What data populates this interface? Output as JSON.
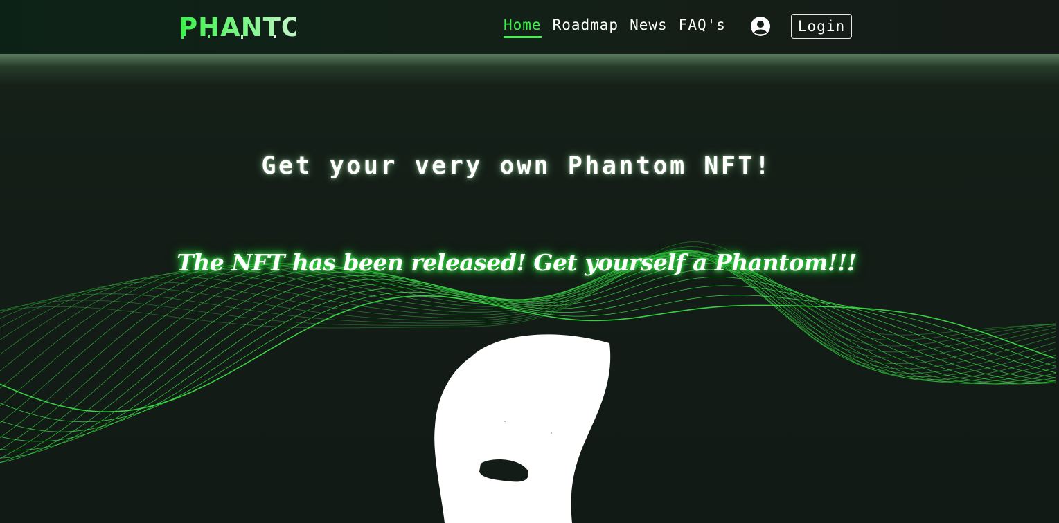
{
  "brand": {
    "logo_text": "PHANTOM",
    "accent_color": "#3df04a"
  },
  "nav": {
    "links": [
      {
        "label": "Home",
        "active": true
      },
      {
        "label": "Roadmap",
        "active": false
      },
      {
        "label": "News",
        "active": false
      },
      {
        "label": "FAQ's",
        "active": false
      }
    ],
    "user_icon": "user-circle-icon",
    "login_label": "Login"
  },
  "hero": {
    "title": "Get your very own Phantom NFT!",
    "subtitle": "The NFT has been released! Get yourself a Phantom!!!"
  },
  "colors": {
    "background": "#131c16",
    "wave": "#3df04a",
    "text": "#ffffff"
  }
}
